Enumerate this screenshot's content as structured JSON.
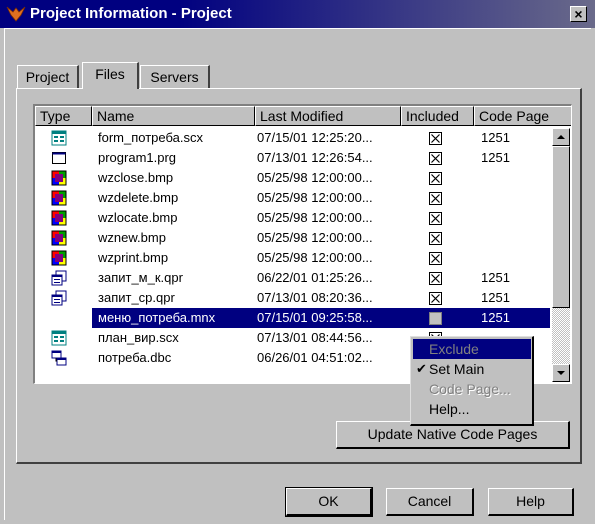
{
  "window": {
    "title": "Project Information - Project",
    "close_label": "×"
  },
  "tabs": [
    {
      "label": "Project",
      "active": false
    },
    {
      "label": "Files",
      "active": true
    },
    {
      "label": "Servers",
      "active": false
    }
  ],
  "columns": {
    "type": "Type",
    "name": "Name",
    "modified": "Last Modified",
    "included": "Included",
    "code_page": "Code Page"
  },
  "files": [
    {
      "icon": "form-icon",
      "name": "form_потреба.scx",
      "modified": "07/15/01 12:25:20...",
      "code_page": "1251"
    },
    {
      "icon": "program-icon",
      "name": "program1.prg",
      "modified": "07/13/01 12:26:54...",
      "code_page": "1251"
    },
    {
      "icon": "bitmap-icon",
      "name": "wzclose.bmp",
      "modified": "05/25/98 12:00:00...",
      "code_page": ""
    },
    {
      "icon": "bitmap-icon",
      "name": "wzdelete.bmp",
      "modified": "05/25/98 12:00:00...",
      "code_page": ""
    },
    {
      "icon": "bitmap-icon",
      "name": "wzlocate.bmp",
      "modified": "05/25/98 12:00:00...",
      "code_page": ""
    },
    {
      "icon": "bitmap-icon",
      "name": "wznew.bmp",
      "modified": "05/25/98 12:00:00...",
      "code_page": ""
    },
    {
      "icon": "bitmap-icon",
      "name": "wzprint.bmp",
      "modified": "05/25/98 12:00:00...",
      "code_page": ""
    },
    {
      "icon": "query-icon",
      "name": "запит_м_к.qpr",
      "modified": "06/22/01 01:25:26...",
      "code_page": "1251"
    },
    {
      "icon": "query-icon",
      "name": "запит_ср.qpr",
      "modified": "07/13/01 08:20:36...",
      "code_page": "1251"
    },
    {
      "icon": "menu-icon",
      "name": "меню_потреба.mnx",
      "modified": "07/15/01 09:25:58...",
      "code_page": "1251",
      "selected": true
    },
    {
      "icon": "form-icon",
      "name": "план_вир.scx",
      "modified": "07/13/01 08:44:56...",
      "code_page": ""
    },
    {
      "icon": "database-icon",
      "name": "потреба.dbc",
      "modified": "06/26/01 04:51:02...",
      "code_page": ""
    }
  ],
  "context_menu": {
    "items": [
      {
        "label": "Exclude",
        "disabled": true,
        "highlighted": true
      },
      {
        "label": "Set Main",
        "checked": true
      },
      {
        "label": "Code Page...",
        "disabled": true
      },
      {
        "label": "Help..."
      }
    ]
  },
  "buttons": {
    "update": "Update Native Code Pages",
    "ok": "OK",
    "cancel": "Cancel",
    "help": "Help"
  },
  "colors": {
    "selection": "#000080",
    "title_bar": "#000080",
    "face": "#c0c0c0"
  }
}
